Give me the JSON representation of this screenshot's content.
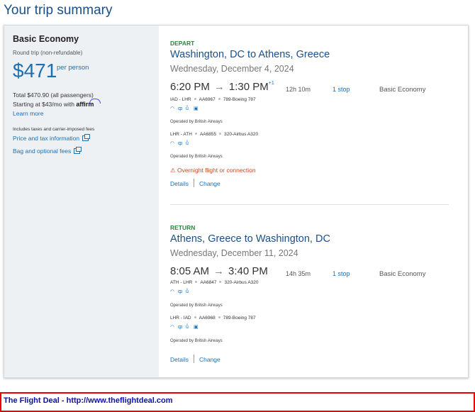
{
  "page_title": "Your trip summary",
  "fare": {
    "name": "Basic Economy",
    "type": "Round trip (non-refundable)",
    "price": "$471",
    "per_person": "per person",
    "total": "Total $470.90 (all passengers)",
    "starting": "Starting at $43/mo with",
    "affirm": "affirm",
    "learn_more": "Learn more",
    "includes": "Includes taxes and carrier-imposed fees",
    "price_tax_link": "Price and tax information",
    "bag_link": "Bag and optional fees"
  },
  "depart": {
    "label": "DEPART",
    "route": "Washington, DC to Athens, Greece",
    "date": "Wednesday, December 4, 2024",
    "dep_time": "6:20 PM",
    "arr_time": "1:30 PM",
    "day_offset": "+1",
    "duration": "12h 10m",
    "stops": "1 stop",
    "cabin": "Basic Economy",
    "legs": [
      {
        "route": "IAD - LHR",
        "flight": "AA6967",
        "aircraft": "789-Boeing 787",
        "operated": "Operated by British Airways"
      },
      {
        "route": "LHR - ATH",
        "flight": "AA6855",
        "aircraft": "320-Airbus A320",
        "operated": "Operated by British Airways"
      }
    ],
    "warning": "Overnight flight or connection",
    "details": "Details",
    "change": "Change"
  },
  "return": {
    "label": "RETURN",
    "route": "Athens, Greece to Washington, DC",
    "date": "Wednesday, December 11, 2024",
    "dep_time": "8:05 AM",
    "arr_time": "3:40 PM",
    "duration": "14h 35m",
    "stops": "1 stop",
    "cabin": "Basic Economy",
    "legs": [
      {
        "route": "ATH - LHR",
        "flight": "AA6847",
        "aircraft": "320-Airbus A320",
        "operated": "Operated by British Airways"
      },
      {
        "route": "LHR - IAD",
        "flight": "AA6968",
        "aircraft": "789-Boeing 787",
        "operated": "Operated by British Airways"
      }
    ],
    "details": "Details",
    "change": "Change"
  },
  "footer": "The Flight Deal - http://www.theflightdeal.com",
  "colors": {
    "accent": "#1a6fb5",
    "title": "#1b4f8a",
    "green": "#2e8540",
    "warning": "#c64a1c"
  }
}
